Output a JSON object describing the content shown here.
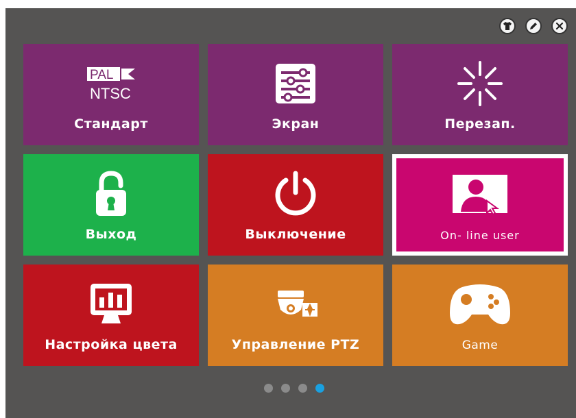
{
  "window": {
    "background": "#555453"
  },
  "top_controls": [
    {
      "name": "skin-button",
      "icon": "tshirt-icon"
    },
    {
      "name": "edit-button",
      "icon": "pencil-icon"
    },
    {
      "name": "close-button",
      "icon": "close-icon"
    }
  ],
  "tiles": [
    {
      "label": "Стандарт",
      "icon": "pal-ntsc-icon",
      "color": "#7c2a6f",
      "icon_text_top": "PAL",
      "icon_text_bottom": "NTSC"
    },
    {
      "label": "Экран",
      "icon": "display-settings-icon",
      "color": "#7c2a6f"
    },
    {
      "label": "Перезап.",
      "icon": "restart-spinner-icon",
      "color": "#7c2a6f"
    },
    {
      "label": "Выход",
      "icon": "lock-icon",
      "color": "#1db14b"
    },
    {
      "label": "Выключение",
      "icon": "power-icon",
      "color": "#be141e"
    },
    {
      "label": "On- line  user",
      "icon": "online-user-icon",
      "color": "#c9066f",
      "selected": true
    },
    {
      "label": "Настройка цвета",
      "icon": "color-settings-monitor-icon",
      "color": "#be141e"
    },
    {
      "label": "Управление PTZ",
      "icon": "ptz-camera-icon",
      "color": "#d57d23"
    },
    {
      "label": "Game",
      "icon": "gamepad-icon",
      "color": "#d57d23"
    }
  ],
  "pager": {
    "count": 4,
    "active_index": 3,
    "active_color": "#1aa1e1",
    "inactive_color": "#8b8b8b"
  }
}
